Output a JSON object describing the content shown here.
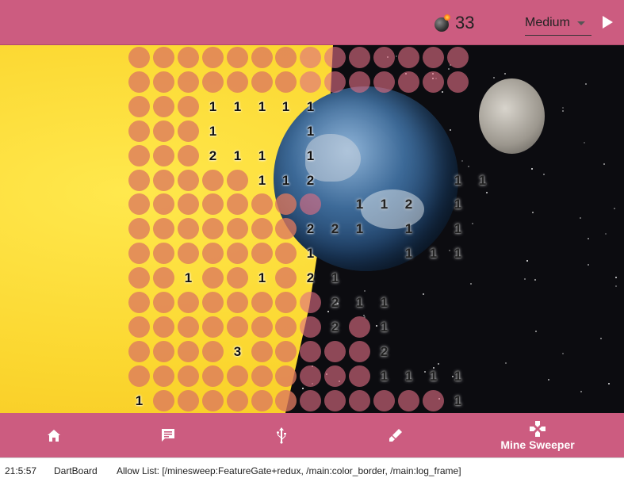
{
  "header": {
    "bomb_icon": "bomb-icon",
    "mine_count": "33",
    "difficulty": "Medium",
    "play_icon": "play-icon"
  },
  "board": {
    "columns": 15,
    "rows": 15,
    "revealed_numbers": [
      {
        "row": 2,
        "col": 3,
        "v": "1"
      },
      {
        "row": 2,
        "col": 4,
        "v": "1"
      },
      {
        "row": 2,
        "col": 5,
        "v": "1"
      },
      {
        "row": 2,
        "col": 6,
        "v": "1"
      },
      {
        "row": 2,
        "col": 7,
        "v": "1"
      },
      {
        "row": 3,
        "col": 3,
        "v": "1"
      },
      {
        "row": 3,
        "col": 7,
        "v": "1"
      },
      {
        "row": 4,
        "col": 3,
        "v": "2"
      },
      {
        "row": 4,
        "col": 4,
        "v": "1"
      },
      {
        "row": 4,
        "col": 5,
        "v": "1"
      },
      {
        "row": 4,
        "col": 7,
        "v": "1"
      },
      {
        "row": 5,
        "col": 5,
        "v": "1"
      },
      {
        "row": 5,
        "col": 6,
        "v": "1"
      },
      {
        "row": 5,
        "col": 7,
        "v": "2"
      },
      {
        "row": 5,
        "col": 13,
        "v": "1"
      },
      {
        "row": 5,
        "col": 14,
        "v": "1"
      },
      {
        "row": 6,
        "col": 9,
        "v": "1"
      },
      {
        "row": 6,
        "col": 10,
        "v": "1"
      },
      {
        "row": 6,
        "col": 11,
        "v": "2"
      },
      {
        "row": 6,
        "col": 13,
        "v": "1"
      },
      {
        "row": 7,
        "col": 7,
        "v": "2"
      },
      {
        "row": 7,
        "col": 8,
        "v": "2"
      },
      {
        "row": 7,
        "col": 9,
        "v": "1"
      },
      {
        "row": 7,
        "col": 11,
        "v": "1"
      },
      {
        "row": 7,
        "col": 13,
        "v": "1"
      },
      {
        "row": 8,
        "col": 7,
        "v": "1"
      },
      {
        "row": 8,
        "col": 11,
        "v": "1"
      },
      {
        "row": 8,
        "col": 12,
        "v": "1"
      },
      {
        "row": 8,
        "col": 13,
        "v": "1"
      },
      {
        "row": 9,
        "col": 2,
        "v": "1"
      },
      {
        "row": 9,
        "col": 5,
        "v": "1"
      },
      {
        "row": 9,
        "col": 7,
        "v": "2"
      },
      {
        "row": 9,
        "col": 8,
        "v": "1"
      },
      {
        "row": 10,
        "col": 8,
        "v": "2"
      },
      {
        "row": 10,
        "col": 9,
        "v": "1"
      },
      {
        "row": 10,
        "col": 10,
        "v": "1"
      },
      {
        "row": 11,
        "col": 8,
        "v": "2"
      },
      {
        "row": 11,
        "col": 10,
        "v": "1"
      },
      {
        "row": 12,
        "col": 4,
        "v": "3"
      },
      {
        "row": 12,
        "col": 10,
        "v": "2"
      },
      {
        "row": 13,
        "col": 10,
        "v": "1"
      },
      {
        "row": 13,
        "col": 11,
        "v": "1"
      },
      {
        "row": 13,
        "col": 12,
        "v": "1"
      },
      {
        "row": 13,
        "col": 13,
        "v": "1"
      },
      {
        "row": 14,
        "col": 0,
        "v": "1"
      },
      {
        "row": 14,
        "col": 13,
        "v": "1"
      }
    ],
    "empty_cells": [
      [
        2,
        8
      ],
      [
        2,
        9
      ],
      [
        2,
        10
      ],
      [
        2,
        11
      ],
      [
        2,
        12
      ],
      [
        2,
        13
      ],
      [
        2,
        14
      ],
      [
        3,
        4
      ],
      [
        3,
        5
      ],
      [
        3,
        6
      ],
      [
        3,
        8
      ],
      [
        3,
        9
      ],
      [
        3,
        10
      ],
      [
        3,
        11
      ],
      [
        3,
        12
      ],
      [
        3,
        13
      ],
      [
        3,
        14
      ],
      [
        4,
        6
      ],
      [
        4,
        8
      ],
      [
        4,
        9
      ],
      [
        4,
        10
      ],
      [
        4,
        11
      ],
      [
        4,
        12
      ],
      [
        4,
        13
      ],
      [
        4,
        14
      ],
      [
        5,
        8
      ],
      [
        5,
        9
      ],
      [
        5,
        10
      ],
      [
        5,
        11
      ],
      [
        5,
        12
      ],
      [
        6,
        8
      ],
      [
        6,
        12
      ],
      [
        6,
        14
      ],
      [
        7,
        10
      ],
      [
        7,
        12
      ],
      [
        7,
        14
      ],
      [
        8,
        8
      ],
      [
        8,
        9
      ],
      [
        8,
        10
      ],
      [
        8,
        14
      ],
      [
        9,
        9
      ],
      [
        9,
        10
      ],
      [
        9,
        11
      ],
      [
        9,
        12
      ],
      [
        9,
        13
      ],
      [
        9,
        14
      ],
      [
        10,
        11
      ],
      [
        10,
        12
      ],
      [
        10,
        13
      ],
      [
        10,
        14
      ],
      [
        11,
        11
      ],
      [
        11,
        12
      ],
      [
        11,
        13
      ],
      [
        11,
        14
      ],
      [
        12,
        11
      ],
      [
        12,
        12
      ],
      [
        12,
        13
      ],
      [
        12,
        14
      ],
      [
        13,
        14
      ],
      [
        14,
        14
      ],
      [
        0,
        14
      ],
      [
        1,
        14
      ]
    ]
  },
  "nav": {
    "items": [
      {
        "icon": "home-icon"
      },
      {
        "icon": "chat-icon"
      },
      {
        "icon": "usb-icon"
      },
      {
        "icon": "brush-icon"
      },
      {
        "icon": "gamepad-icon",
        "label": "Mine Sweeper"
      }
    ],
    "mine_sweeper_label": "Mine Sweeper"
  },
  "status": {
    "time": "21:5:57",
    "app": "DartBoard",
    "allow_list": "Allow List: [/minesweep:FeatureGate+redux, /main:color_border, /main:log_frame]"
  },
  "colors": {
    "accent": "#cc5c80",
    "sun": "#fbd730",
    "space": "#0c0c10"
  }
}
